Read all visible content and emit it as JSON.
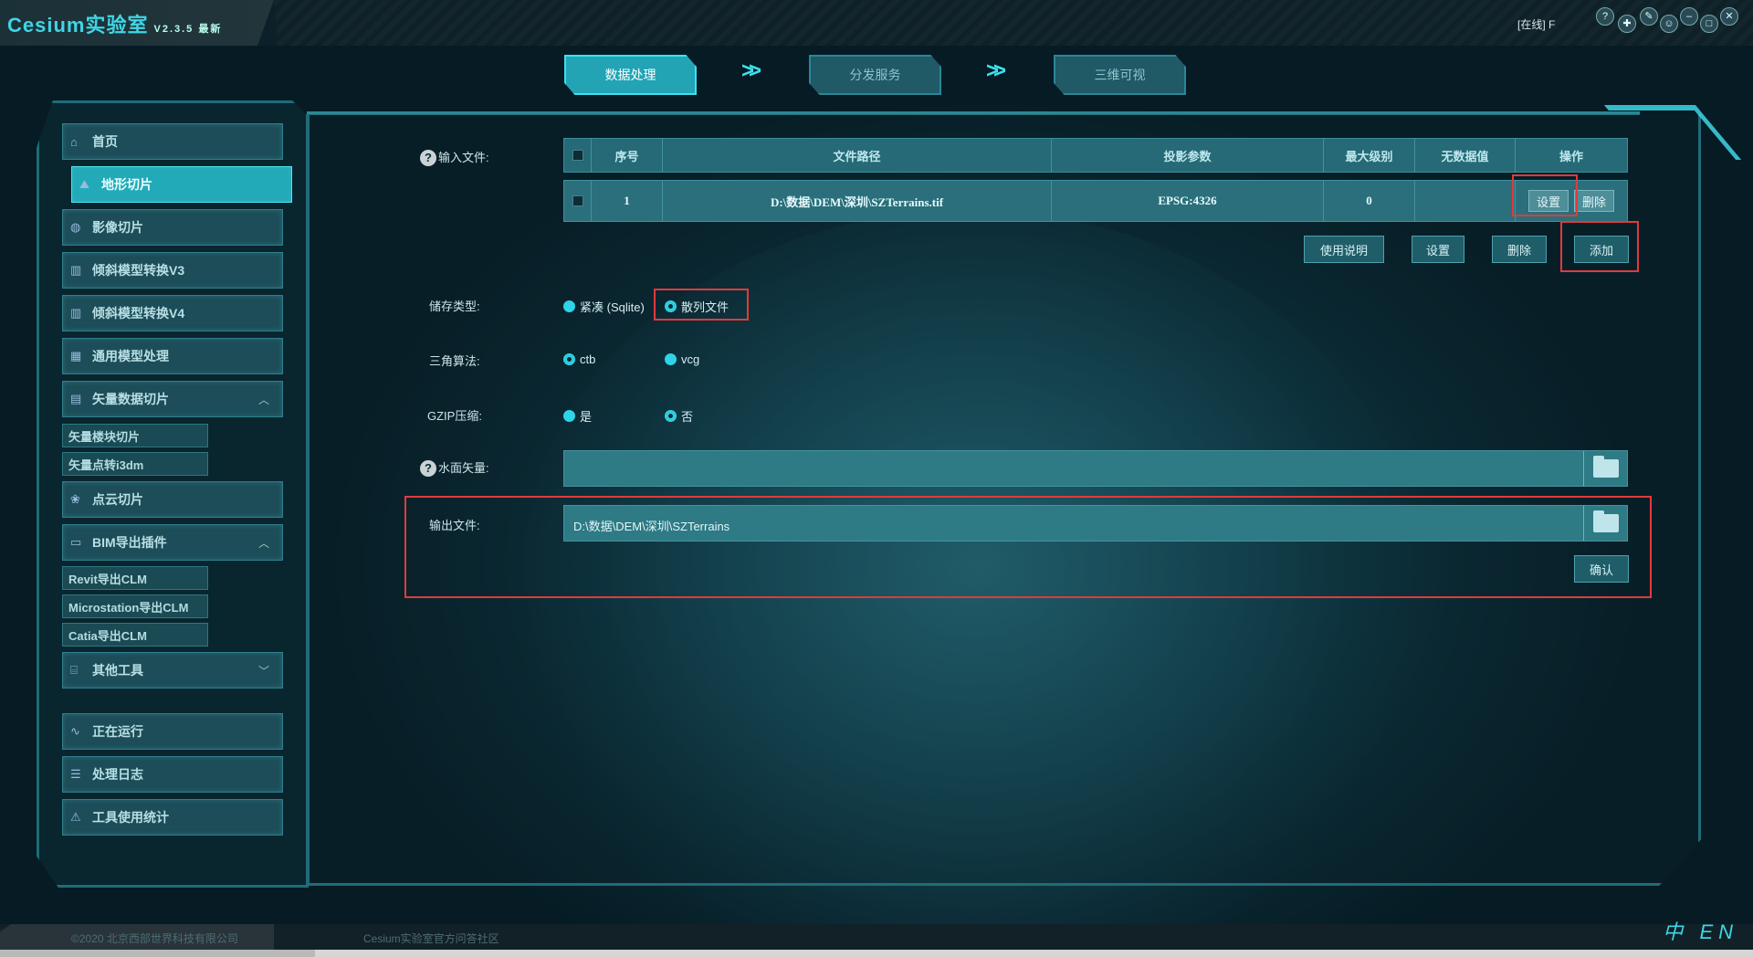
{
  "app": {
    "title": "Cesium实验室",
    "version": "V2.3.5",
    "badge": "最新",
    "status": "[在线] F"
  },
  "window_icons": [
    "help-icon",
    "settings-icon",
    "tools-icon",
    "user-icon",
    "minimize-icon",
    "maximize-icon",
    "close-icon"
  ],
  "steps": [
    {
      "label": "数据处理",
      "active": true
    },
    {
      "label": "分发服务",
      "active": false
    },
    {
      "label": "三维可视",
      "active": false
    }
  ],
  "sidebar": {
    "items": [
      {
        "label": "首页"
      },
      {
        "label": "地形切片",
        "selected": true
      },
      {
        "label": "影像切片"
      },
      {
        "label": "倾斜模型转换V3"
      },
      {
        "label": "倾斜模型转换V4"
      },
      {
        "label": "通用模型处理"
      },
      {
        "label": "矢量数据切片"
      },
      {
        "label": "矢量楼块切片"
      },
      {
        "label": "矢量点转i3dm"
      },
      {
        "label": "点云切片"
      },
      {
        "label": "BIM导出插件"
      },
      {
        "label": "Revit导出CLM"
      },
      {
        "label": "Microstation导出CLM"
      },
      {
        "label": "Catia导出CLM"
      },
      {
        "label": "其他工具"
      },
      {
        "label": "正在运行"
      },
      {
        "label": "处理日志"
      },
      {
        "label": "工具使用统计"
      }
    ]
  },
  "form": {
    "input_label": "输入文件:",
    "table": {
      "columns": [
        "序号",
        "文件路径",
        "投影参数",
        "最大级别",
        "无数据值",
        "操作"
      ],
      "rows": [
        {
          "index": "1",
          "path": "D:\\数据\\DEM\\深圳\\SZTerrains.tif",
          "projection": "EPSG:4326",
          "max_level": "0",
          "nodata": ""
        }
      ],
      "row_actions": {
        "settings": "设置",
        "delete": "删除"
      }
    },
    "buttons": {
      "help": "使用说明",
      "settings": "设置",
      "delete": "删除",
      "add": "添加",
      "confirm": "确认"
    },
    "storage": {
      "label": "储存类型:",
      "options": [
        "紧凑 (Sqlite)",
        "散列文件"
      ],
      "selected": "散列文件"
    },
    "triangle": {
      "label": "三角算法:",
      "options": [
        "ctb",
        "vcg"
      ],
      "selected": "ctb"
    },
    "gzip": {
      "label": "GZIP压缩:",
      "options": [
        "是",
        "否"
      ],
      "selected": "否"
    },
    "water": {
      "label": "水面矢量:",
      "value": ""
    },
    "output": {
      "label": "输出文件:",
      "value": "D:\\数据\\DEM\\深圳\\SZTerrains"
    }
  },
  "footer": {
    "copyright": "©2020 北京西部世界科技有限公司",
    "community": "Cesium实验室官方问答社区",
    "lang_zh": "中",
    "lang_en": "EN"
  }
}
